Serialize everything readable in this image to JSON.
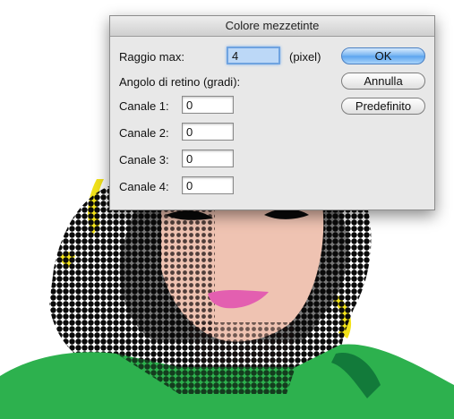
{
  "dialog": {
    "title": "Colore mezzetinte",
    "max_radius_label": "Raggio max:",
    "max_radius_value": "4",
    "unit_label": "(pixel)",
    "screen_angles_label": "Angolo di retino (gradi):",
    "channels": [
      {
        "label": "Canale 1:",
        "value": "0"
      },
      {
        "label": "Canale 2:",
        "value": "0"
      },
      {
        "label": "Canale 3:",
        "value": "0"
      },
      {
        "label": "Canale 4:",
        "value": "0"
      }
    ],
    "buttons": {
      "ok": "OK",
      "cancel": "Annulla",
      "default": "Predefinito"
    }
  },
  "colors": {
    "skin": "#efc3b2",
    "hair": "#0a0a0a",
    "shirt": "#2db14e",
    "collar_shadow": "#127a3a",
    "lips": "#e35fb0",
    "highlight": "#f2e21a",
    "default_button": "#72b2f1"
  }
}
